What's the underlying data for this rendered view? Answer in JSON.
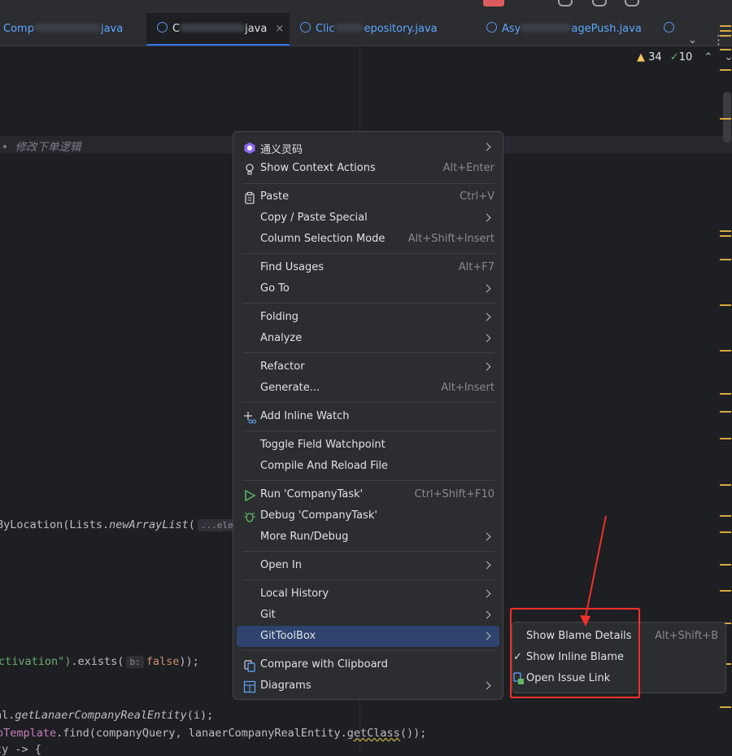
{
  "tabs": [
    {
      "label_prefix": "Comp",
      "label_suffix": "java",
      "active": false
    },
    {
      "label_prefix": "C",
      "label_suffix": "java",
      "active": true,
      "close": "×"
    },
    {
      "label_prefix": "Clic",
      "label_suffix": "epository.java",
      "active": false
    },
    {
      "label_prefix": "Asy",
      "label_suffix": "agePush.java",
      "active": false
    }
  ],
  "inspections": {
    "warnings": "34",
    "weak_warnings": "10",
    "up": "⌃",
    "down": "⌄"
  },
  "code": {
    "line_comment_bullet": "•",
    "line_comment": "修改下单逻辑",
    "line_location_pre": "ByLocation(Lists.",
    "line_location_method": "newArrayList",
    "line_location_open": "(",
    "line_location_hint": "...elem",
    "line_activation_str": "ctivation\")",
    "line_activation_mid": ".exists(",
    "line_activation_hint": "b:",
    "line_activation_kw": "false",
    "line_activation_end": "));",
    "line_real_pre": "al.",
    "line_real_method": "getLanaerCompanyRealEntity",
    "line_real_args": "(i);",
    "line_template_fld": "oTemplate",
    "line_template_mid": ".find(companyQuery, lanaerCompanyRealEntity.",
    "line_template_wavy": "getClass",
    "line_template_end": "());",
    "line_partial": "ty -> {"
  },
  "menu": {
    "items": [
      {
        "label": "通义灵码",
        "icon": "tongyi-icon",
        "submenu": true
      },
      {
        "label": "Show Context Actions",
        "icon": "lightbulb-icon",
        "shortcut": "Alt+Enter"
      },
      {
        "label": "Paste",
        "icon": "clipboard-icon",
        "shortcut": "Ctrl+V"
      },
      {
        "label": "Copy / Paste Special",
        "submenu": true
      },
      {
        "label": "Column Selection Mode",
        "shortcut": "Alt+Shift+Insert"
      },
      {
        "label": "Find Usages",
        "shortcut": "Alt+F7"
      },
      {
        "label": "Go To",
        "submenu": true
      },
      {
        "label": "Folding",
        "submenu": true
      },
      {
        "label": "Analyze",
        "submenu": true
      },
      {
        "label": "Refactor",
        "submenu": true
      },
      {
        "label": "Generate...",
        "shortcut": "Alt+Insert"
      },
      {
        "label": "Add Inline Watch",
        "icon": "inline-watch-icon"
      },
      {
        "label": "Toggle Field Watchpoint"
      },
      {
        "label": "Compile And Reload File"
      },
      {
        "label": "Run 'CompanyTask'",
        "icon": "run-icon",
        "shortcut": "Ctrl+Shift+F10"
      },
      {
        "label": "Debug 'CompanyTask'",
        "icon": "debug-icon"
      },
      {
        "label": "More Run/Debug",
        "submenu": true
      },
      {
        "label": "Open In",
        "submenu": true
      },
      {
        "label": "Local History",
        "submenu": true
      },
      {
        "label": "Git",
        "submenu": true
      },
      {
        "label": "GitToolBox",
        "submenu": true,
        "selected": true
      },
      {
        "label": "Compare with Clipboard",
        "icon": "compare-icon"
      },
      {
        "label": "Diagrams",
        "icon": "diagram-icon",
        "submenu": true
      }
    ]
  },
  "submenu": {
    "items": [
      {
        "label": "Show Blame Details",
        "shortcut": "Alt+Shift+B"
      },
      {
        "label": "Show Inline Blame",
        "checked": true,
        "check": "✓"
      },
      {
        "label": "Open Issue Link",
        "icon": "issue-link-icon"
      }
    ]
  },
  "colors": {
    "accent": "#3574f0",
    "selection": "#2e436e",
    "annotation": "#f0302a",
    "warning": "#f2c55c",
    "ok": "#5fb865"
  }
}
